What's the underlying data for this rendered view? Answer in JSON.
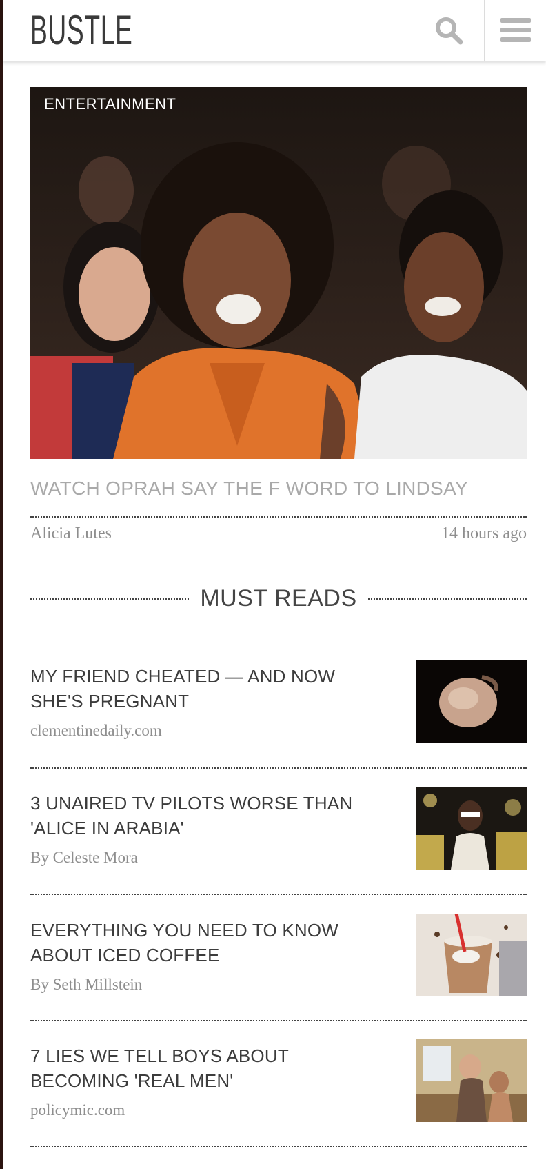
{
  "header": {
    "logo": "BUSTLE",
    "search_icon": "search-icon",
    "menu_icon": "hamburger-menu-icon"
  },
  "hero": {
    "category": "ENTERTAINMENT",
    "title": "WATCH OPRAH SAY THE F WORD TO LINDSAY",
    "author": "Alicia Lutes",
    "time": "14 hours ago"
  },
  "must_reads": {
    "heading": "MUST READS",
    "items": [
      {
        "title": "MY FRIEND CHEATED — AND NOW SHE'S PREGNANT",
        "source": "clementinedaily.com"
      },
      {
        "title": "3 UNAIRED TV PILOTS WORSE THAN 'ALICE IN ARABIA'",
        "source": "By Celeste Mora"
      },
      {
        "title": "EVERYTHING YOU NEED TO KNOW ABOUT ICED COFFEE",
        "source": "By Seth Millstein"
      },
      {
        "title": "7 LIES WE TELL BOYS ABOUT BECOMING 'REAL MEN'",
        "source": "policymic.com"
      }
    ]
  },
  "colors": {
    "accent_dark": "#2b1410",
    "title_gray": "#a9a9a9",
    "text_dark": "#3c3c3c"
  }
}
